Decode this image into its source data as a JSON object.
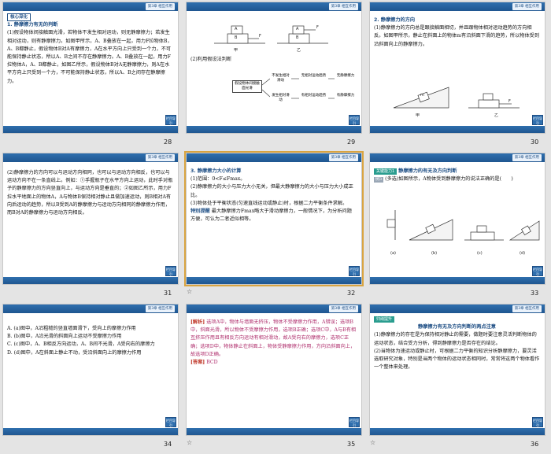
{
  "header_tab": "第3章  相互作用",
  "return_label": "栏目导引",
  "slides": [
    {
      "number": "28",
      "title_box": "核心深化",
      "heading": "1. 静摩擦力有无的判断",
      "body": "(1)假设物体间接触面光滑，若物体不发生相对运动，则无静摩擦力；若发生相对运动，则有静摩擦力。如图甲所示，A、B叠放在一起，用力F拉物体B，A、B都静止，假设物体B对A有摩擦力，A在水平方向上只受到一个力，不可能保持静止状态，所以A、B之间不存在静摩擦力。A、B叠放在一起，用力F拉物体A，A、B都静止，如图乙所示，假设物体B对A无静摩擦力，则A在水平方向上只受到一个力，不可能保持静止状态，所以A、B之间存在静摩擦力。"
    },
    {
      "number": "29",
      "fig_a": "甲",
      "fig_b": "乙",
      "block_a": "A",
      "block_b": "B",
      "force": "F",
      "subheading": "(2)利用假设法判断",
      "flow_start": "假设物体间接触面光滑",
      "flow_up": "不发生相对滑动",
      "flow_up_mid": "无相对运动趋势",
      "flow_up_end": "无静摩擦力",
      "flow_down": "发生相对滑动",
      "flow_down_mid": "有相对运动趋势",
      "flow_down_end": "有静摩擦力"
    },
    {
      "number": "30",
      "heading": "2. 静摩擦力的方向",
      "body": "(1)静摩擦力的方向总是跟接触面相切，并且跟物体相对运动趋势的方向相反。如图甲所示，静止在斜面上的物体m有沿斜面下滑的趋势，所以物体受到沿斜面向上的静摩擦力。",
      "fig_a": "甲",
      "fig_b": "乙",
      "block_m": "m",
      "force": "F"
    },
    {
      "number": "31",
      "body": "(2)静摩擦力的方向可以与运动方向相同，也可以与运动方向相反，也可以与运动方向不在一条直线上。例如：①手握瓶子在水平方向上运动，此时手对瓶子的静摩擦力的方向竖直向上，与运动方向是垂直的；②如图乙所示，用力F拉水平地面上的物体A，A与物体B保持相对静止且做加速运动，则B相对A有向后运动的趋势，所以B受到A的静摩擦力与运动方向相同的静摩擦力作用，而B对A的静摩擦力与运动方向相反。"
    },
    {
      "number": "32",
      "heading": "3. 静摩擦力大小的计算",
      "line1": "(1)范围：0<F≤Fmax。",
      "line2": "(2)静摩擦力的大小与压力大小无关，但最大静摩擦力的大小与压力大小成正比。",
      "line3": "(3)物体处于平衡状态(匀速直线运动或静止)时，根据二力平衡条件求解。",
      "note_label": "特别提醒",
      "note": "最大静摩擦力Fmax略大于滑动摩擦力，一般情况下，为分析问题方便，可认为二者近似相等。",
      "star": "☆"
    },
    {
      "number": "33",
      "key_label": "关键能力1",
      "key_title": "静摩擦力的有无及方向判断",
      "ex_label": "例3",
      "question": "(多选)如图所示，A物体受到静摩擦力的说法正确的是(　　)",
      "sub_a": "(a)",
      "sub_b": "(b)",
      "sub_c": "(c)",
      "sub_d": "(d)"
    },
    {
      "number": "34",
      "optA": "A. (a)图中，A沿粗糙的竖直墙面滑下，受向上的摩擦力作用",
      "optB": "B. (b)图中，A沿光滑的斜面向上运动不受摩擦力作用",
      "optC": "C. (c)图中，A、B相反方向运动，A、B间不光滑，A受向右的摩擦力",
      "optD": "D. (d)图中，A在斜面上静止不动，受沿斜面向上的摩擦力作用"
    },
    {
      "number": "35",
      "analysis_label": "[解析]",
      "analysis": "选项A中，物体与墙面无挤压，物体不受摩擦力作用，A错误；选项B中，斜面光滑，所以物体不受摩擦力作用，选项B正确；选项C中，A与B有相互挤压作用且有相反方向运动有相对滑动，故A受向右的摩擦力，选项C正确；选项D中，物体静止在斜面上，物体受静摩擦力作用，方向沿斜面向上，故选项D正确。",
      "answer_label": "[答案]",
      "answer": "BCD",
      "star": "☆"
    },
    {
      "number": "36",
      "tag": "归纳提升",
      "title": "静摩擦力有无及方向判断的两点注意",
      "p1": "(1)静摩擦力的存在是为保持相对静止的需要，做题时要注意灵活判断物体的运动状态，结合受力分析，得到静摩擦力是否存在的结论。",
      "p2": "(2)当物体为速运动或静止时，可根据二力平衡的知识分析静摩擦力，要灵活选取研究对象，特别是当两个物体的运动状态相同时，常常将这两个物体看作一个整体来处理。",
      "star": "☆"
    }
  ]
}
